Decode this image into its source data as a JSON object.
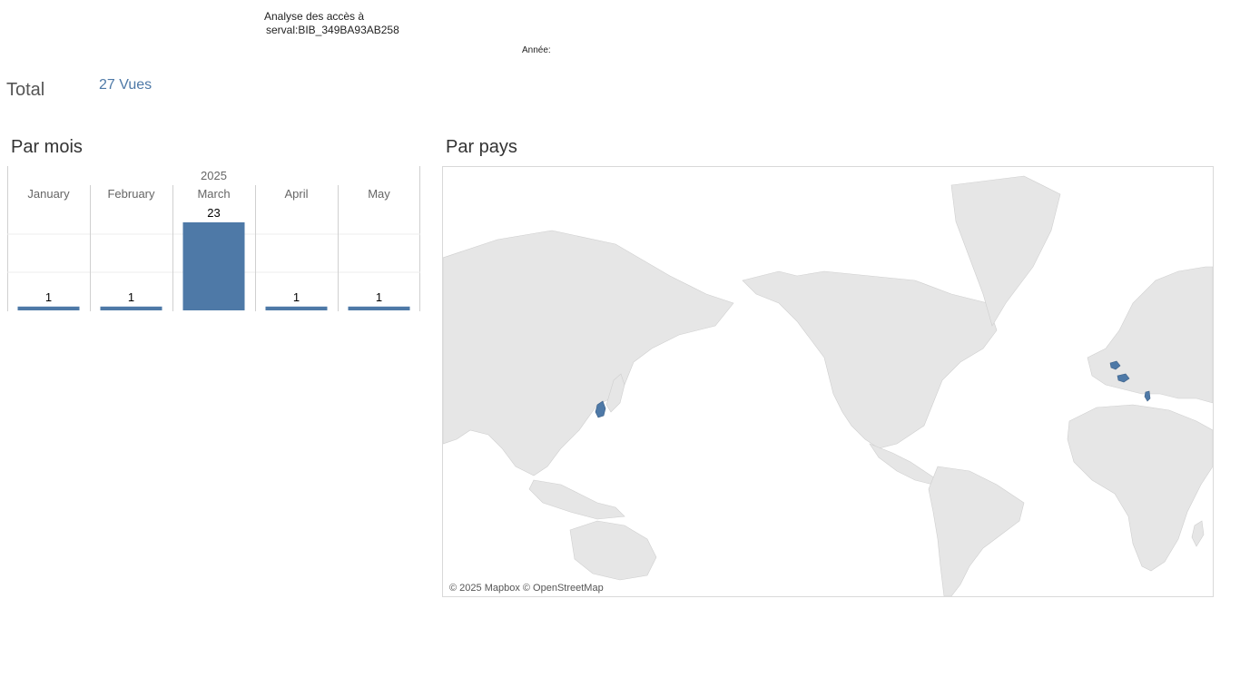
{
  "header": {
    "title_line1": "Analyse des accès à",
    "title_line2": "serval:BIB_349BA93AB258",
    "year_filter_label": "Année:"
  },
  "summary": {
    "total_label": "Total",
    "total_value": "27 Vues"
  },
  "sections": {
    "by_month_title": "Par mois",
    "by_country_title": "Par pays"
  },
  "chart_data": {
    "type": "bar",
    "year": "2025",
    "categories": [
      "January",
      "February",
      "March",
      "April",
      "May"
    ],
    "values": [
      1,
      1,
      23,
      1,
      1
    ],
    "ylim": [
      0,
      23
    ],
    "grid": true,
    "color": "#4e79a7"
  },
  "map": {
    "attribution": "© 2025 Mapbox © OpenStreetMap",
    "land_color": "#e6e6e6",
    "highlight_color": "#4e79a7",
    "highlighted_countries": [
      "South Korea",
      "Belgium",
      "Switzerland",
      "Albania"
    ]
  },
  "colors": {
    "accent": "#4e79a7",
    "text": "#333333",
    "gridline": "#e6e6e6"
  }
}
